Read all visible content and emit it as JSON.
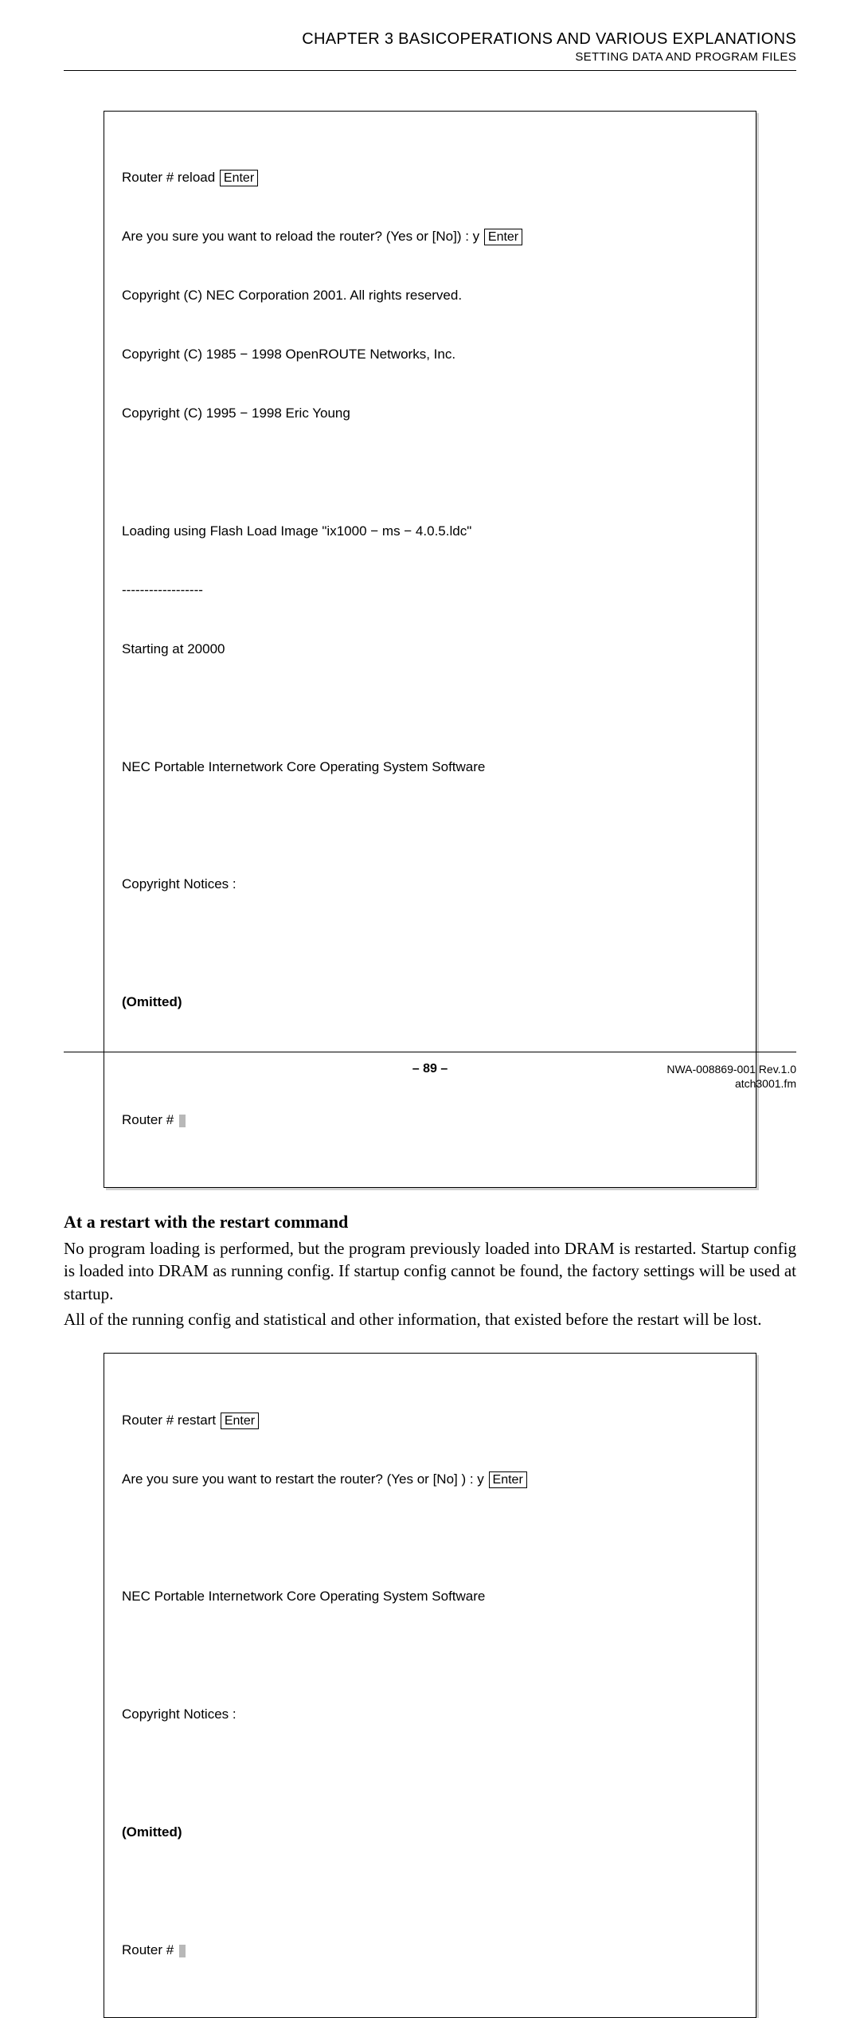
{
  "header": {
    "chapter": "CHAPTER 3   BASICOPERATIONS AND VARIOUS EXPLANATIONS",
    "section": "SETTING DATA AND PROGRAM FILES"
  },
  "terminal1": {
    "l1_a": "Router # reload ",
    "l1_key": "Enter",
    "l2_a": "Are you sure you want to reload the router? (Yes or [No]) : y ",
    "l2_key": "Enter",
    "l3": "Copyright (C) NEC Corporation 2001. All rights reserved.",
    "l4": "Copyright (C) 1985 − 1998 OpenROUTE Networks, Inc.",
    "l5": "Copyright (C) 1995 − 1998 Eric Young",
    "l6": "Loading using Flash Load Image \"ix1000 − ms − 4.0.5.ldc\"",
    "l7": "------------------",
    "l8": "Starting at 20000",
    "l9": "NEC Portable Internetwork Core Operating System Software",
    "l10": "Copyright Notices :",
    "l11": "(Omitted)",
    "l12": "Router # "
  },
  "body": {
    "heading": "At a restart with the restart command",
    "p1": "No program loading is performed, but the program previously loaded into DRAM is restarted. Startup config is loaded into DRAM as running config. If startup config cannot be found, the factory settings will be used at startup.",
    "p2": "All of the running config and statistical and other information, that existed before the restart will be lost."
  },
  "terminal2": {
    "l1_a": "Router # restart ",
    "l1_key": "Enter",
    "l2_a": "Are you sure you want to restart the router? (Yes or [No] ) : y ",
    "l2_key": "Enter",
    "l3": "NEC Portable Internetwork Core Operating System Software",
    "l4": "Copyright Notices :",
    "l5": "(Omitted)",
    "l6": "Router # "
  },
  "footer": {
    "page": "– 89 –",
    "docid": "NWA-008869-001 Rev.1.0",
    "file": "atch3001.fm"
  }
}
